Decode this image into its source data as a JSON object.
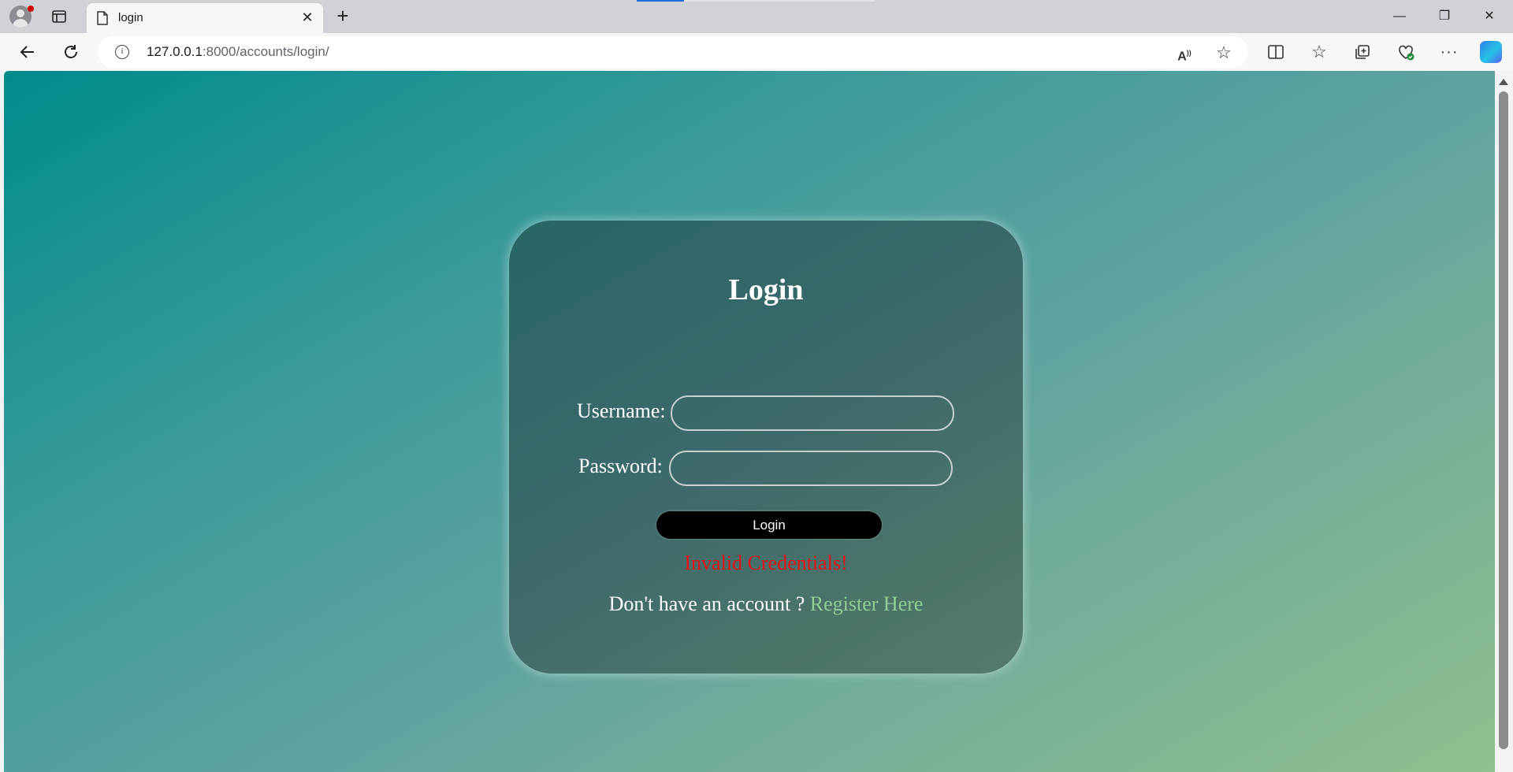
{
  "browser": {
    "tab_title": "login",
    "url_host": "127.0.0.1",
    "url_rest": ":8000/accounts/login/",
    "icons": [
      "profile-icon",
      "tab-actions-icon",
      "page-icon",
      "close-icon",
      "new-tab-icon",
      "minimize-icon",
      "restore-icon",
      "close-window-icon",
      "back-icon",
      "refresh-icon",
      "info-icon",
      "read-aloud-icon",
      "favorite-star-icon",
      "split-screen-icon",
      "favorites-icon",
      "collections-icon",
      "browser-essentials-icon",
      "more-icon",
      "copilot-icon"
    ]
  },
  "login": {
    "title": "Login",
    "username_label": "Username:",
    "username_value": "",
    "password_label": "Password:",
    "password_value": "",
    "button_label": "Login",
    "error_message": "Invalid Credentials!",
    "register_prompt": "Don't have an account ?",
    "register_link": "Register Here"
  },
  "colors": {
    "error": "#e8111a",
    "link": "#8fcf95",
    "card": "#3f6a6b",
    "button": "#000000"
  }
}
